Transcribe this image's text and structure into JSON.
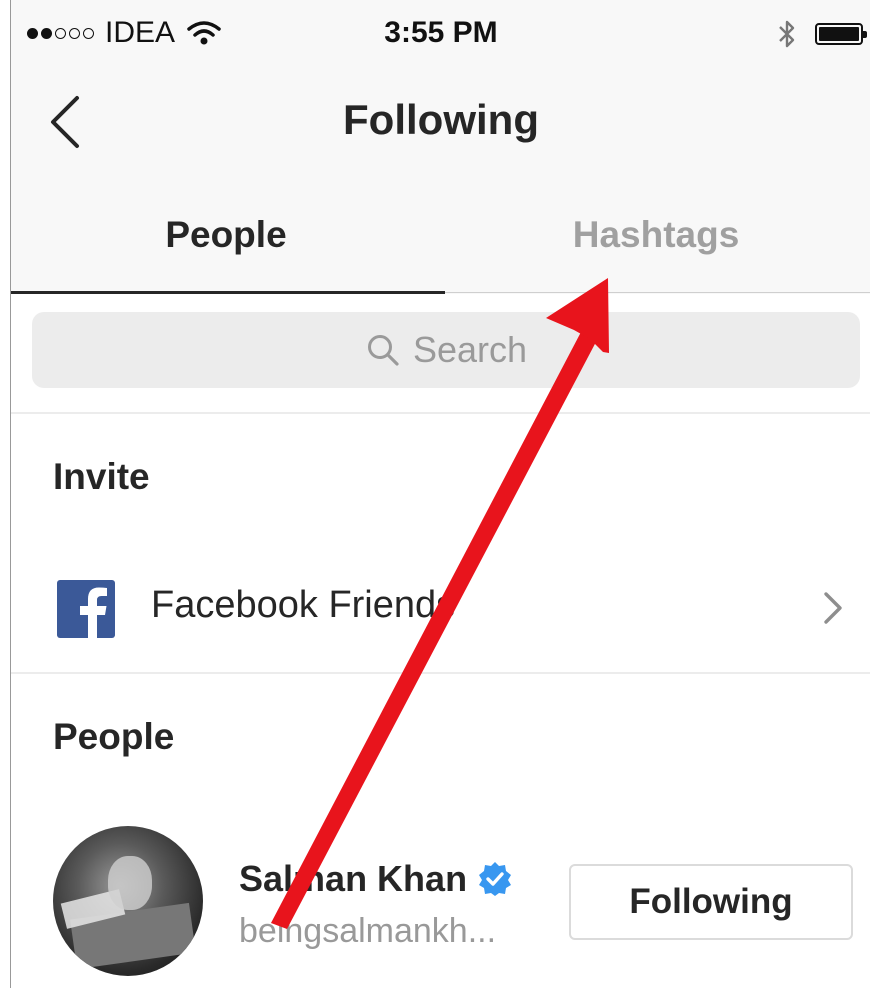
{
  "status_bar": {
    "carrier": "IDEA",
    "time": "3:55 PM",
    "signal_dots": [
      "filled",
      "filled",
      "empty",
      "empty",
      "empty"
    ]
  },
  "nav": {
    "title": "Following",
    "back_icon": "chevron-left-icon"
  },
  "tabs": [
    {
      "label": "People",
      "active": true
    },
    {
      "label": "Hashtags",
      "active": false
    }
  ],
  "search": {
    "placeholder": "Search",
    "icon": "search-icon"
  },
  "sections": {
    "invite": {
      "title": "Invite",
      "items": [
        {
          "label": "Facebook Friends",
          "icon": "facebook-icon"
        }
      ]
    },
    "people": {
      "title": "People",
      "items": [
        {
          "name": "Salman Khan",
          "handle": "beingsalmankh...",
          "verified": true,
          "button_label": "Following"
        }
      ]
    }
  },
  "colors": {
    "facebook": "#3b5998",
    "verified_badge": "#3897f0",
    "annotation_arrow": "#e8141c",
    "inactive_tab": "#a0a0a0"
  }
}
